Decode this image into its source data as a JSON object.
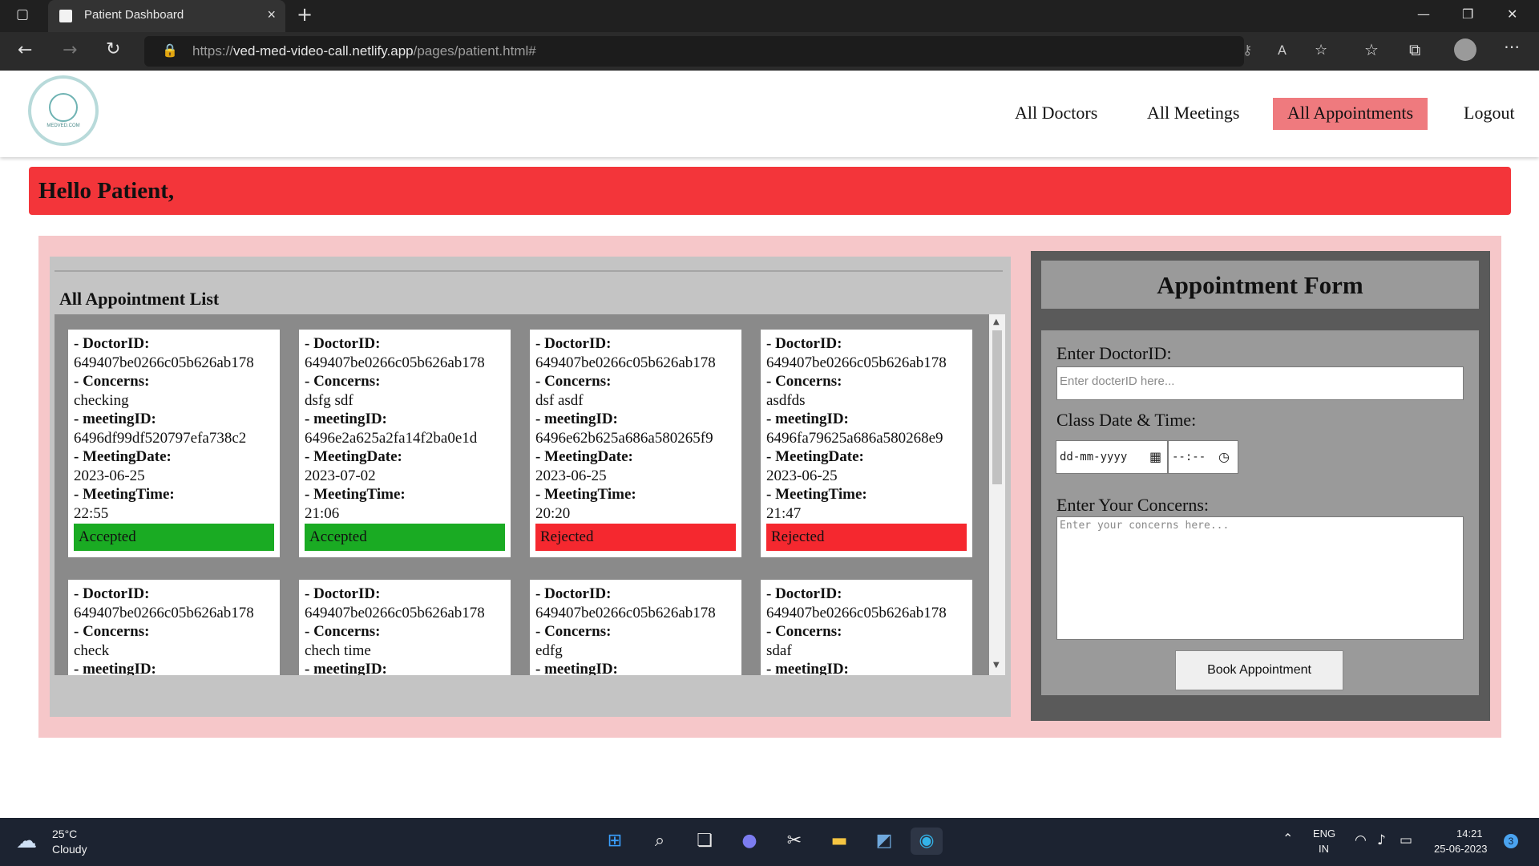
{
  "browser": {
    "tab_title": "Patient Dashboard",
    "tab_close": "×",
    "new_tab": "+",
    "url_scheme": "https://",
    "url_host": "ved-med-video-call.netlify.app",
    "url_path": "/pages/patient.html#",
    "window_minimize": "—",
    "window_restore": "❐",
    "window_close": "✕"
  },
  "header": {
    "logo_text": "MEDVED.COM",
    "nav": [
      "All Doctors",
      "All Meetings",
      "All Appointments",
      "Logout"
    ]
  },
  "greeting": "Hello Patient,",
  "list": {
    "title": "All Appointment List",
    "labels": {
      "doctor": "- DoctorID:",
      "concerns": "- Concerns:",
      "meeting_id": "- meetingID:",
      "meeting_date": "- MeetingDate:",
      "meeting_time": "- MeetingTime:"
    },
    "appointments": [
      {
        "doctor_id": "649407be0266c05b626ab178",
        "concerns": "checking",
        "meeting_id": "6496df99df520797efa738c2",
        "meeting_date": "2023-06-25",
        "meeting_time": "22:55",
        "status": "Accepted"
      },
      {
        "doctor_id": "649407be0266c05b626ab178",
        "concerns": "dsfg sdf",
        "meeting_id": "6496e2a625a2fa14f2ba0e1d",
        "meeting_date": "2023-07-02",
        "meeting_time": "21:06",
        "status": "Accepted"
      },
      {
        "doctor_id": "649407be0266c05b626ab178",
        "concerns": "dsf asdf",
        "meeting_id": "6496e62b625a686a580265f9",
        "meeting_date": "2023-06-25",
        "meeting_time": "20:20",
        "status": "Rejected"
      },
      {
        "doctor_id": "649407be0266c05b626ab178",
        "concerns": "asdfds",
        "meeting_id": "6496fa79625a686a580268e9",
        "meeting_date": "2023-06-25",
        "meeting_time": "21:47",
        "status": "Rejected"
      },
      {
        "doctor_id": "649407be0266c05b626ab178",
        "concerns": "check",
        "meeting_id": "",
        "meeting_date": "",
        "meeting_time": "",
        "status": ""
      },
      {
        "doctor_id": "649407be0266c05b626ab178",
        "concerns": "chech time",
        "meeting_id": "",
        "meeting_date": "",
        "meeting_time": "",
        "status": ""
      },
      {
        "doctor_id": "649407be0266c05b626ab178",
        "concerns": "edfg",
        "meeting_id": "",
        "meeting_date": "",
        "meeting_time": "",
        "status": ""
      },
      {
        "doctor_id": "649407be0266c05b626ab178",
        "concerns": "sdaf",
        "meeting_id": "",
        "meeting_date": "",
        "meeting_time": "",
        "status": ""
      }
    ]
  },
  "form": {
    "title": "Appointment Form",
    "doctor_label": "Enter DoctorID:",
    "doctor_placeholder": "Enter docterID here...",
    "datetime_label": "Class Date & Time:",
    "date_placeholder": "dd-mm-yyyy",
    "time_placeholder": "--:--",
    "concerns_label": "Enter Your Concerns:",
    "concerns_placeholder": "Enter your concerns here...",
    "submit": "Book Appointment"
  },
  "colors": {
    "accepted": "#1aab23",
    "rejected": "#f5282f",
    "nav_active": "#ef7a7e",
    "hello_bar": "#f3353a"
  },
  "taskbar": {
    "temperature": "25°C",
    "weather": "Cloudy",
    "lang": "ENG",
    "region": "IN",
    "time": "14:21",
    "date": "25-06-2023",
    "notifications": "3"
  }
}
